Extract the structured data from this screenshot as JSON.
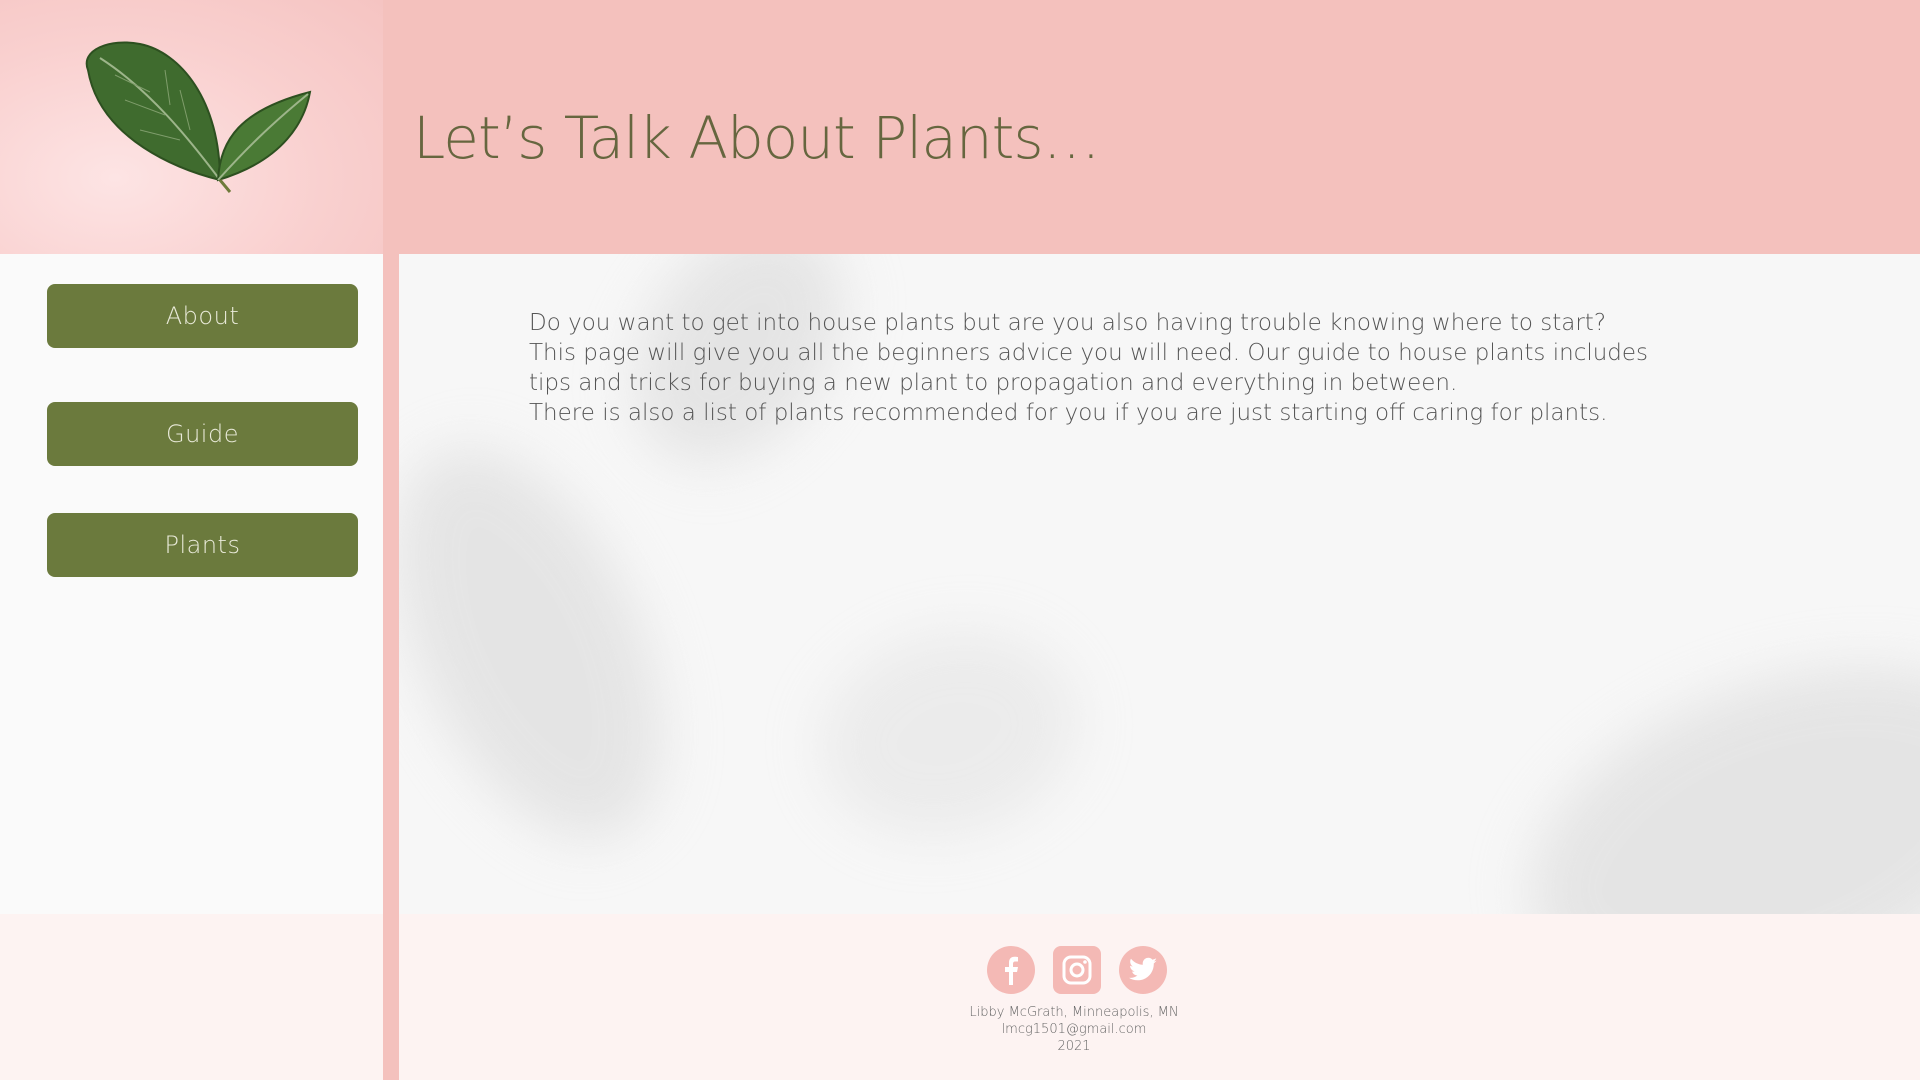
{
  "header": {
    "title": "Let’s Talk About Plants…"
  },
  "nav": {
    "items": [
      {
        "label": "About"
      },
      {
        "label": "Guide"
      },
      {
        "label": "Plants"
      }
    ]
  },
  "main": {
    "intro_lines": [
      "Do you want to get into house plants but are you also having trouble knowing where to start?",
      "This page will give you all the beginners advice you will need. Our guide to house plants includes",
      "tips and tricks for buying a new plant to propagation and everything in between.",
      "There is also a list of plants recommended for you if you are just starting off caring for plants."
    ]
  },
  "footer": {
    "social": [
      "facebook-icon",
      "instagram-icon",
      "twitter-icon"
    ],
    "author_line": "Libby McGrath, Minneapolis, MN",
    "email": "lmcg1501@gmail.com",
    "year": "2021"
  },
  "colors": {
    "header_pink": "#f4c1bd",
    "button_green": "#6b7a3d",
    "title_text": "#66663f",
    "footer_bg": "#fdf3f2",
    "social_pink": "#f4b9b5"
  }
}
